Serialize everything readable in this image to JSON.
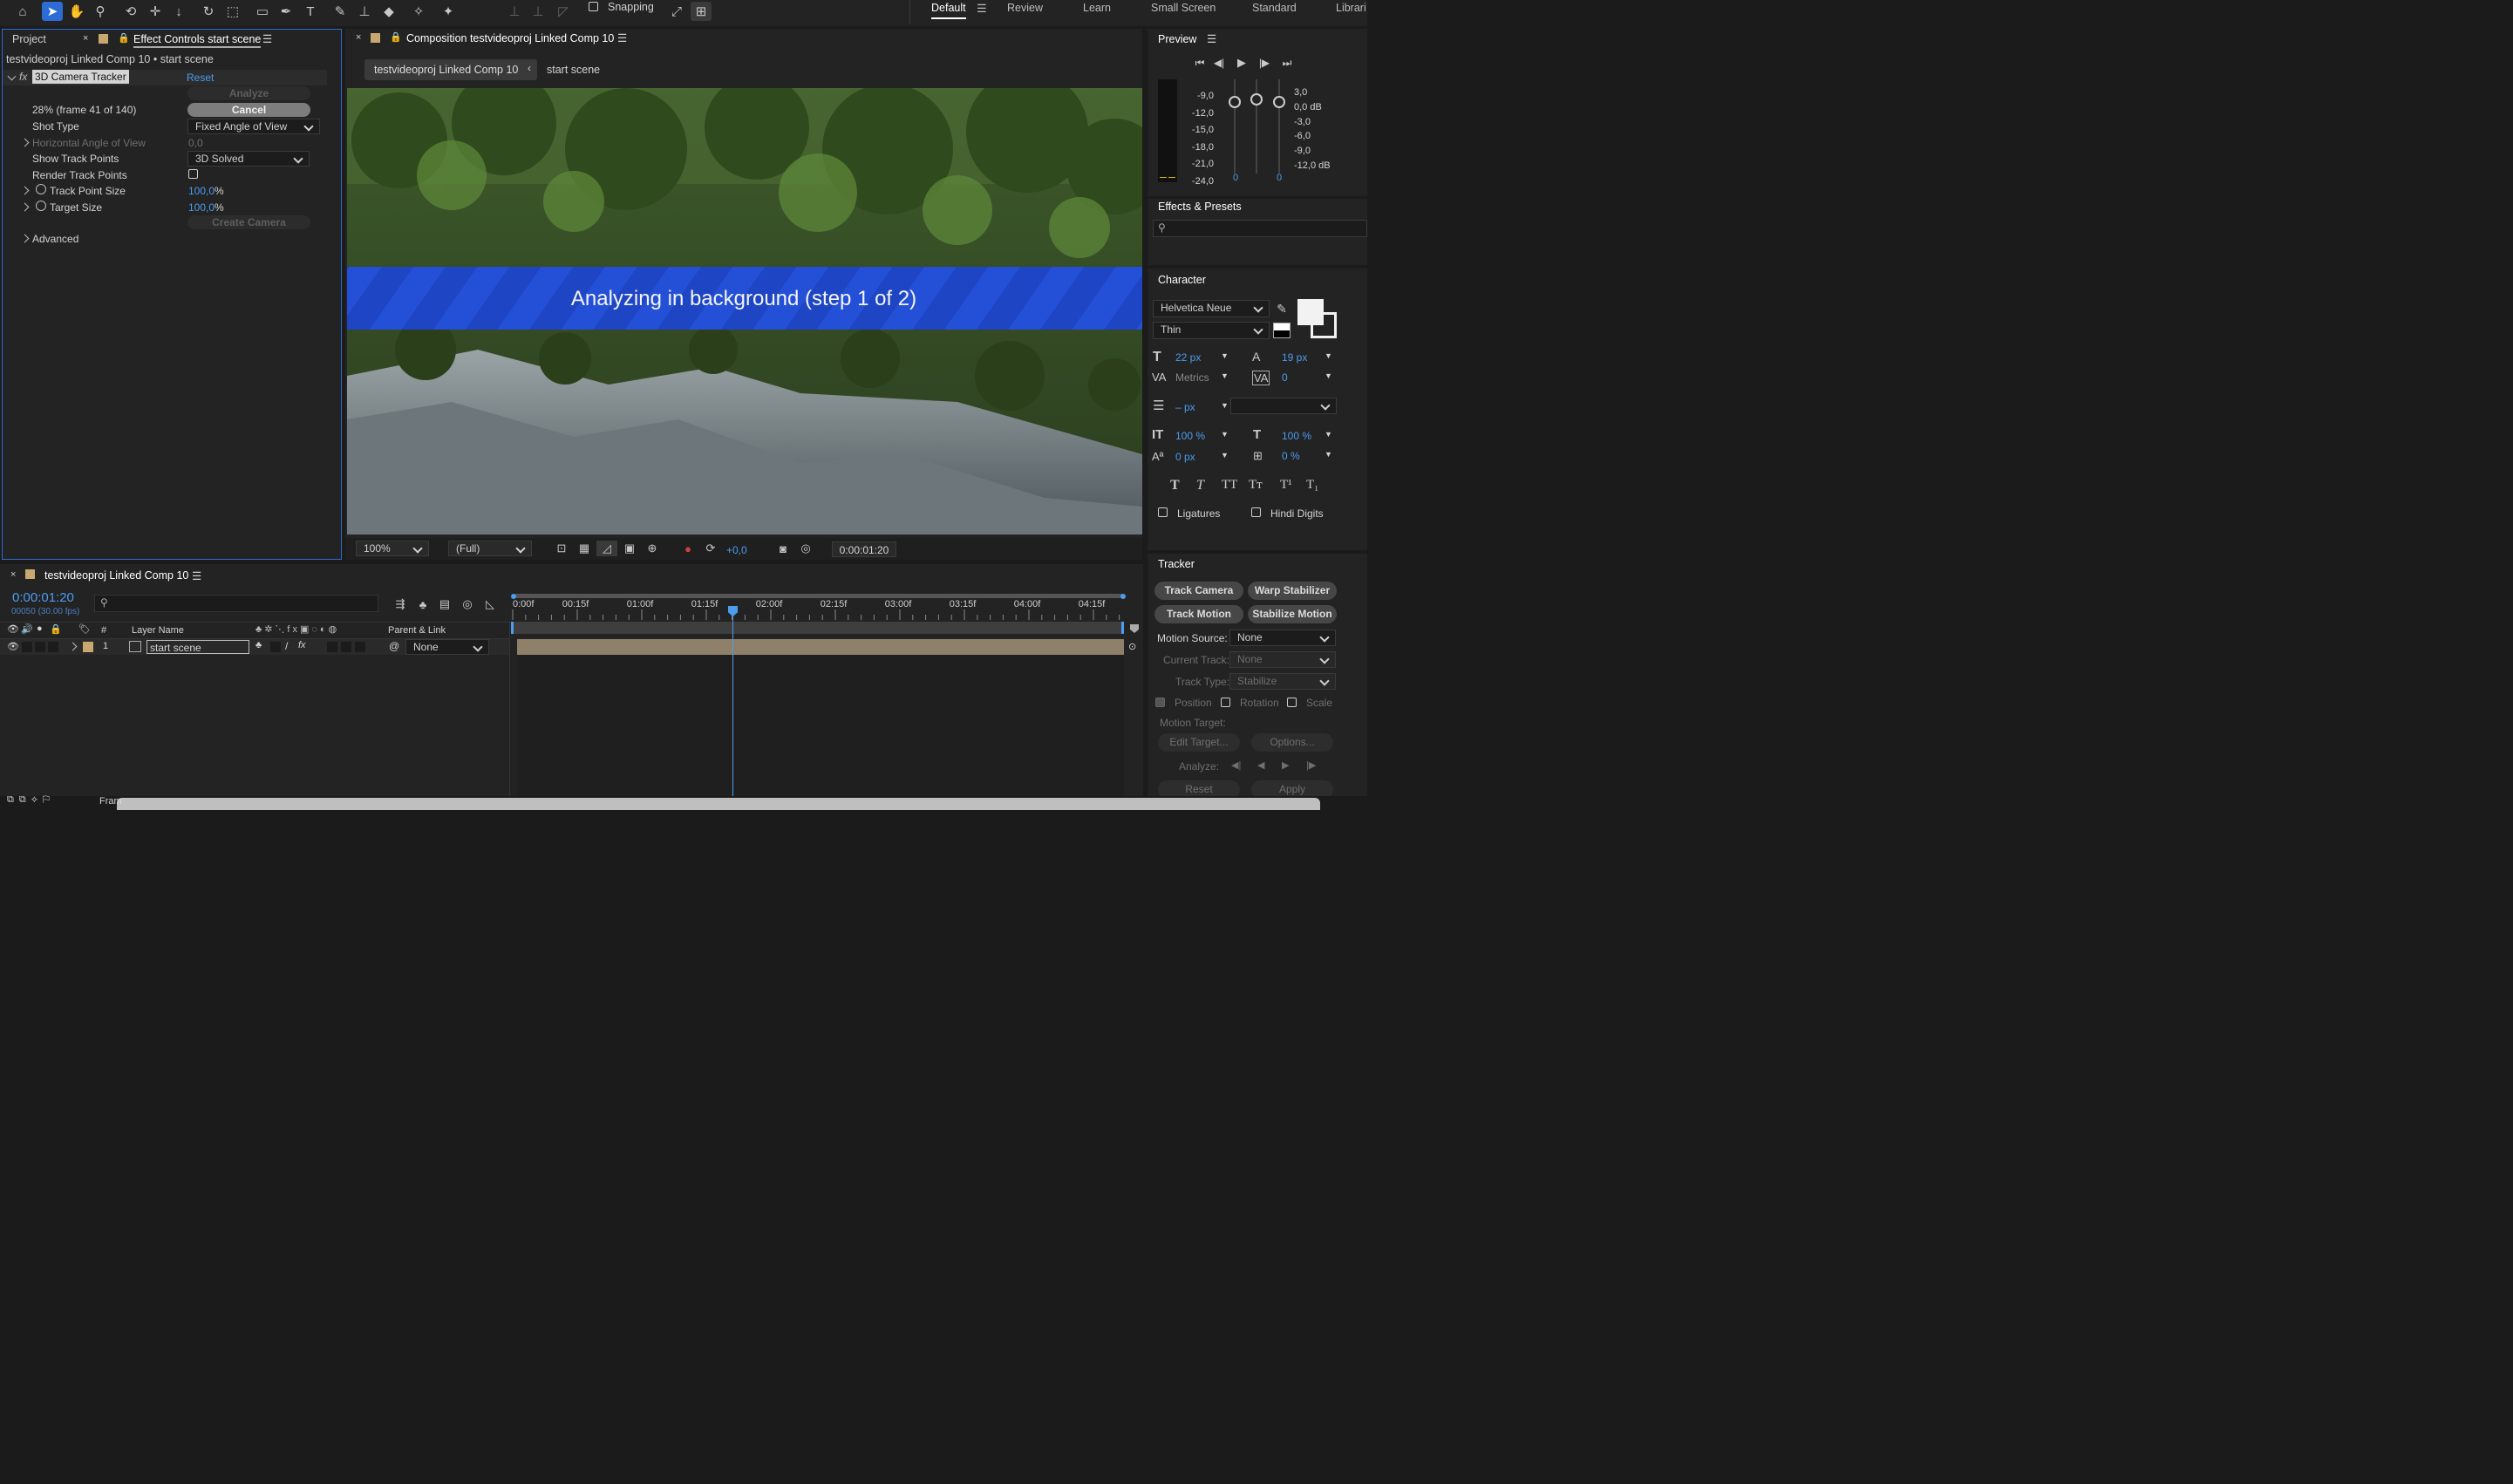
{
  "workspaces": [
    "Default",
    "Review",
    "Learn",
    "Small Screen",
    "Standard",
    "Librari"
  ],
  "toolbar": {
    "snapping": "Snapping"
  },
  "left_panel": {
    "tab_project": "Project",
    "tab_effect": "Effect Controls start scene",
    "breadcrumb": "testvideoproj Linked Comp 10 • start scene",
    "effect_name": "3D Camera Tracker",
    "reset": "Reset",
    "analyze": "Analyze",
    "progress": "28% (frame 41 of 140)",
    "cancel": "Cancel",
    "shot_type_label": "Shot Type",
    "shot_type_value": "Fixed Angle of View",
    "haov_label": "Horizontal Angle of View",
    "haov_value": "0,0",
    "show_tp_label": "Show Track Points",
    "show_tp_value": "3D Solved",
    "render_tp_label": "Render Track Points",
    "tps_label": "Track Point Size",
    "tps_value": "100,0",
    "tps_unit": "%",
    "target_label": "Target Size",
    "target_value": "100,0",
    "target_unit": "%",
    "create_camera": "Create Camera",
    "advanced": "Advanced"
  },
  "comp": {
    "tab": "Composition testvideoproj Linked Comp 10",
    "crumb1": "testvideoproj Linked Comp 10",
    "crumb2": "start scene",
    "banner": "Analyzing in background (step 1 of 2)",
    "zoom": "100%",
    "resolution": "(Full)",
    "exposure": "+0,0",
    "timecode": "0:00:01:20"
  },
  "preview": {
    "title": "Preview",
    "db_left": [
      "-9,0",
      "-12,0",
      "-15,0",
      "-18,0",
      "-21,0",
      "-24,0"
    ],
    "db_right": [
      "3,0",
      "0,0 dB",
      "-3,0",
      "-6,0",
      "-9,0",
      "-12,0 dB"
    ],
    "zero1": "0",
    "zero2": "0"
  },
  "effects_presets": {
    "title": "Effects & Presets"
  },
  "character": {
    "title": "Character",
    "font": "Helvetica Neue",
    "style": "Thin",
    "size": "22 px",
    "leading": "19 px",
    "kerning": "Metrics",
    "tracking": "0",
    "stroke": "– px",
    "vscale": "100 %",
    "hscale": "100 %",
    "baseline": "0 px",
    "tsume": "0 %",
    "ligatures": "Ligatures",
    "hindi": "Hindi Digits"
  },
  "tracker": {
    "title": "Tracker",
    "track_camera": "Track Camera",
    "warp": "Warp Stabilizer",
    "track_motion": "Track Motion",
    "stabilize": "Stabilize Motion",
    "motion_source_label": "Motion Source:",
    "motion_source": "None",
    "current_track_label": "Current Track:",
    "current_track": "None",
    "track_type_label": "Track Type:",
    "track_type": "Stabilize",
    "position": "Position",
    "rotation": "Rotation",
    "scale": "Scale",
    "motion_target": "Motion Target:",
    "edit_target": "Edit Target...",
    "options": "Options...",
    "analyze": "Analyze:",
    "reset": "Reset",
    "apply": "Apply"
  },
  "timeline": {
    "tab": "testvideoproj Linked Comp 10",
    "timecode": "0:00:01:20",
    "fps": "00050 (30.00 fps)",
    "col_num": "#",
    "col_layer": "Layer Name",
    "col_parent": "Parent & Link",
    "layer_num": "1",
    "layer_name": "start scene",
    "parent": "None",
    "ruler": [
      "0:00f",
      "00:15f",
      "01:00f",
      "01:15f",
      "02:00f",
      "02:15f",
      "03:00f",
      "03:15f",
      "04:00f",
      "04:15f"
    ],
    "status": "Fram"
  }
}
